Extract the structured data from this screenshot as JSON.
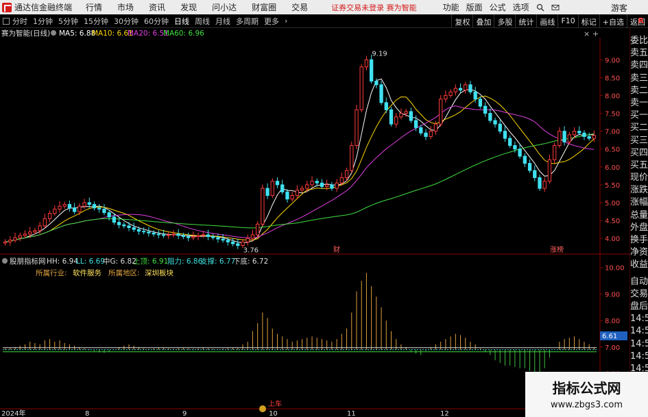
{
  "menubar": {
    "title": "通达信金融终端",
    "items": [
      "行情",
      "市场",
      "资讯",
      "发现",
      "问小达",
      "财富圈",
      "交易"
    ],
    "notice": "证券交易未登录 赛为智能",
    "right_items": [
      "功能",
      "版面",
      "公式",
      "选项"
    ],
    "guest": "游客"
  },
  "toolbar": {
    "periods": [
      "分时",
      "1分钟",
      "5分钟",
      "15分钟",
      "30分钟",
      "60分钟",
      "日线",
      "周线",
      "月线",
      "多周期",
      "更多"
    ],
    "active_period": "日线",
    "buttons": [
      "复权",
      "叠加",
      "多股",
      "统计",
      "画线",
      "F10",
      "标记",
      "+自选",
      "返回"
    ],
    "badge": "R"
  },
  "main_chart": {
    "stock": "赛为智能(日线)",
    "ma": [
      {
        "label": "MA5: 6.88",
        "color": "#ffffff"
      },
      {
        "label": "MA10: 6.61",
        "color": "#ffd700"
      },
      {
        "label": "MA20: 6.51",
        "color": "#e040e0"
      },
      {
        "label": "MA60: 6.96",
        "color": "#40e040"
      }
    ],
    "high_label": "9.19",
    "low_label": "3.76",
    "event_labels": [
      "财",
      "涨榜"
    ]
  },
  "indicator": {
    "name": "股朋指标网",
    "values": [
      {
        "label": "HH: 6.94",
        "color": "#dddddd"
      },
      {
        "label": "LL: 6.69",
        "color": "#40e0e0"
      },
      {
        "label": "中G: 6.82",
        "color": "#dddddd"
      },
      {
        "label": "上顶: 6.91",
        "color": "#40e040"
      },
      {
        "label": "阻力: 6.86",
        "color": "#40e0e0"
      },
      {
        "label": "支撑: 6.77",
        "color": "#40e0e0"
      },
      {
        "label": "下底: 6.72",
        "color": "#dddddd"
      }
    ],
    "industry_label": "所属行业:",
    "industry_value": "软件服务",
    "region_label": "所属地区:",
    "region_value": "深圳板块",
    "current_value": "6.61",
    "signal": "上车"
  },
  "x_axis": [
    "2024年",
    "8",
    "9",
    "10",
    "11",
    "12"
  ],
  "chart_data": [
    {
      "type": "candlestick",
      "title": "赛为智能(日线)",
      "y_ticks": [
        4.0,
        4.5,
        5.0,
        5.5,
        6.0,
        6.5,
        7.0,
        7.5,
        8.0,
        8.5,
        9.0
      ],
      "ylim": [
        3.6,
        9.35
      ],
      "categories": [
        "2024年",
        "8",
        "9",
        "10",
        "11",
        "12"
      ],
      "close": [
        3.9,
        3.95,
        4.02,
        4.08,
        4.12,
        4.18,
        4.22,
        4.35,
        4.55,
        4.7,
        4.82,
        4.9,
        4.95,
        4.85,
        4.75,
        4.9,
        5.0,
        4.95,
        4.85,
        4.82,
        4.72,
        4.6,
        4.45,
        4.38,
        4.35,
        4.3,
        4.25,
        4.2,
        4.18,
        4.15,
        4.12,
        4.1,
        4.08,
        4.1,
        4.12,
        4.08,
        4.05,
        4.02,
        4.05,
        4.08,
        4.1,
        4.05,
        4.02,
        3.98,
        3.95,
        3.9,
        3.85,
        3.8,
        3.9,
        4.0,
        4.1,
        4.4,
        5.4,
        5.2,
        5.6,
        5.5,
        5.3,
        5.1,
        5.2,
        5.35,
        5.4,
        5.5,
        5.6,
        5.55,
        5.45,
        5.5,
        5.4,
        5.55,
        5.7,
        5.9,
        6.6,
        7.6,
        8.8,
        9.0,
        8.4,
        8.3,
        7.8,
        7.6,
        7.2,
        7.4,
        7.5,
        7.55,
        7.3,
        7.1,
        6.95,
        6.85,
        7.0,
        7.2,
        7.9,
        8.0,
        8.1,
        8.2,
        8.15,
        8.3,
        8.1,
        7.9,
        7.7,
        7.5,
        7.3,
        7.2,
        7.0,
        6.8,
        6.6,
        6.5,
        6.3,
        6.1,
        5.9,
        5.7,
        5.4,
        5.6,
        6.2,
        6.6,
        7.0,
        6.7,
        6.9,
        7.0,
        6.95,
        6.85,
        6.8,
        6.88
      ],
      "series": [
        {
          "name": "MA5",
          "color": "#ffffff",
          "last": 6.88
        },
        {
          "name": "MA10",
          "color": "#ffd700",
          "last": 6.61
        },
        {
          "name": "MA20",
          "color": "#e040e0",
          "last": 6.51
        },
        {
          "name": "MA60",
          "color": "#40e040",
          "last": 6.96
        }
      ],
      "annotations": [
        {
          "text": "9.19",
          "value": 9.19
        },
        {
          "text": "3.76",
          "value": 3.76
        }
      ]
    },
    {
      "type": "bar",
      "title": "股朋指标网",
      "y_ticks": [
        6.0,
        7.0,
        8.0,
        9.0,
        10.0
      ],
      "ylim": [
        5.6,
        10.2
      ],
      "baseline": 6.9,
      "values": [
        6.95,
        6.98,
        7.0,
        7.05,
        7.1,
        7.2,
        7.15,
        7.1,
        7.25,
        7.3,
        7.2,
        7.25,
        7.15,
        7.1,
        7.05,
        7.0,
        6.95,
        6.92,
        6.85,
        6.8,
        6.78,
        6.82,
        6.9,
        7.0,
        7.05,
        7.1,
        7.05,
        7.0,
        6.95,
        6.93,
        6.95,
        7.0,
        6.98,
        6.95,
        6.93,
        6.96,
        6.98,
        6.95,
        6.93,
        6.95,
        6.97,
        6.95,
        6.93,
        6.92,
        6.94,
        6.96,
        6.98,
        6.97,
        7.1,
        7.2,
        7.6,
        7.9,
        8.3,
        8.1,
        7.7,
        7.5,
        7.4,
        7.3,
        7.2,
        7.25,
        7.3,
        7.35,
        7.4,
        7.35,
        7.3,
        7.25,
        7.2,
        7.3,
        7.5,
        7.7,
        8.3,
        9.1,
        9.5,
        9.8,
        9.3,
        8.9,
        8.5,
        8.0,
        7.6,
        7.3,
        7.1,
        7.0,
        6.8,
        6.75,
        6.7,
        6.85,
        7.0,
        7.1,
        7.2,
        7.3,
        7.4,
        7.5,
        7.45,
        7.35,
        7.2,
        7.1,
        6.95,
        6.8,
        6.7,
        6.5,
        6.4,
        6.3,
        6.3,
        6.25,
        6.2,
        6.2,
        6.1,
        6.05,
        6.0,
        6.2,
        6.6,
        6.9,
        7.2,
        7.3,
        7.35,
        7.4,
        7.3,
        7.2,
        7.1,
        7.0
      ]
    }
  ]
}
